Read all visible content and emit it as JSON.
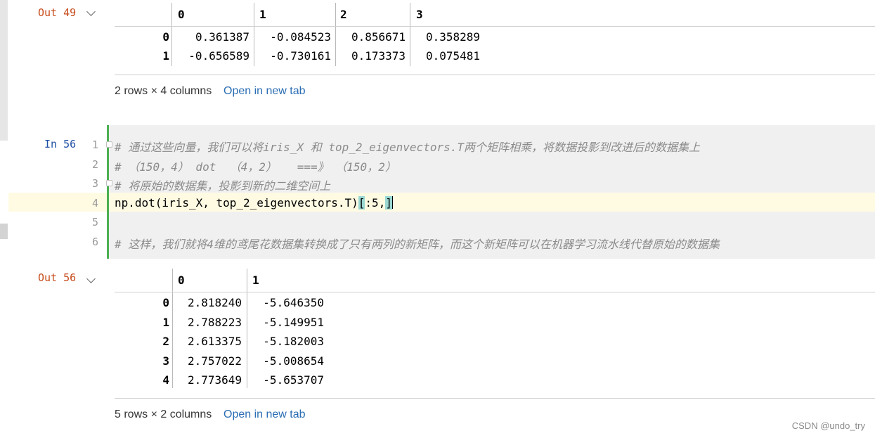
{
  "out49": {
    "label": "Out 49",
    "columns": [
      "0",
      "1",
      "2",
      "3"
    ],
    "rows": [
      {
        "index": "0",
        "values": [
          "0.361387",
          "-0.084523",
          "0.856671",
          "0.358289"
        ]
      },
      {
        "index": "1",
        "values": [
          "-0.656589",
          "-0.730161",
          "0.173373",
          "0.075481"
        ]
      }
    ],
    "shape_text": "2 rows × 4 columns",
    "open_link": "Open in new tab"
  },
  "in56": {
    "label": "In 56",
    "line_numbers": [
      "1",
      "2",
      "3",
      "4",
      "5",
      "6"
    ],
    "lines": {
      "l1": "# 通过这些向量，我们可以将iris_X 和 top_2_eigenvectors.T两个矩阵相乘，将数据投影到改进后的数据集上",
      "l2": "# （150，4） dot  （4，2）   ===》 （150，2）",
      "l3": "# 将原始的数据集，投影到新的二维空间上",
      "l4_a": "np.dot(iris_X, top_2_eigenvectors.T)",
      "l4_b": "[",
      "l4_c": ":5,",
      "l4_d": "]",
      "l5": "",
      "l6": "# 这样，我们就将4维的鸢尾花数据集转换成了只有两列的新矩阵，而这个新矩阵可以在机器学习流水线代替原始的数据集"
    }
  },
  "out56": {
    "label": "Out 56",
    "columns": [
      "0",
      "1"
    ],
    "rows": [
      {
        "index": "0",
        "values": [
          "2.818240",
          "-5.646350"
        ]
      },
      {
        "index": "1",
        "values": [
          "2.788223",
          "-5.149951"
        ]
      },
      {
        "index": "2",
        "values": [
          "2.613375",
          "-5.182003"
        ]
      },
      {
        "index": "3",
        "values": [
          "2.757022",
          "-5.008654"
        ]
      },
      {
        "index": "4",
        "values": [
          "2.773649",
          "-5.653707"
        ]
      }
    ],
    "shape_text": "5 rows × 2 columns",
    "open_link": "Open in new tab"
  },
  "watermark": "CSDN @undo_try",
  "colors": {
    "out_prompt": "#c74a1a",
    "in_prompt": "#1f4fa3",
    "link": "#2a6db3",
    "cell_bar": "#4caf50",
    "bracket_highlight": "#9ad7d3"
  }
}
